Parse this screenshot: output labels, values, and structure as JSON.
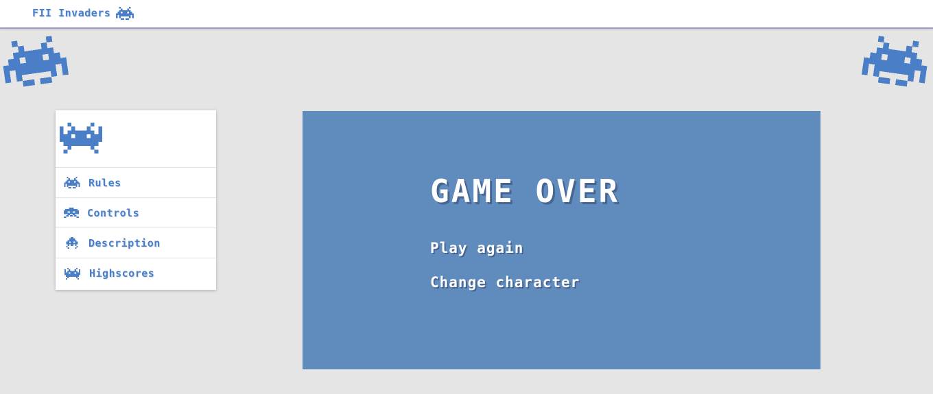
{
  "app": {
    "title": "FII Invaders"
  },
  "colors": {
    "accent": "#4a7fc8",
    "game_bg": "#5f8bbd",
    "page_bg": "#e5e5e5"
  },
  "icons": {
    "brand": "crab-invader-icon",
    "corner_left": "crab-invader-icon",
    "corner_right": "crab-invader-icon",
    "menu_logo": "squid-invader-icon"
  },
  "sidebar": {
    "items": [
      {
        "label": "Rules",
        "icon": "crab-invader-icon"
      },
      {
        "label": "Controls",
        "icon": "octopus-invader-icon"
      },
      {
        "label": "Description",
        "icon": "ufo-invader-icon"
      },
      {
        "label": "Highscores",
        "icon": "squid-invader-icon"
      }
    ]
  },
  "game": {
    "title": "GAME OVER",
    "options": {
      "play_again": "Play again",
      "change_character": "Change character"
    }
  }
}
